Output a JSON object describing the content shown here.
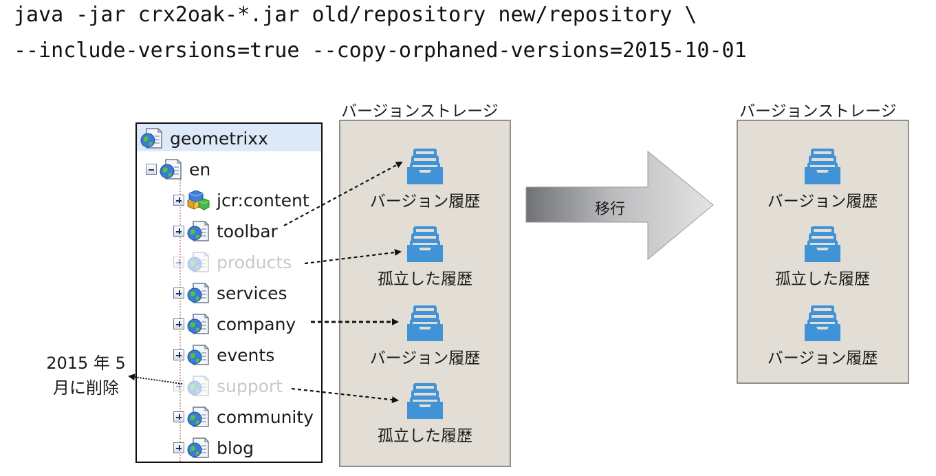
{
  "command": {
    "line1": "java -jar crx2oak-*.jar old/repository new/repository \\",
    "line2": "--include-versions=true --copy-orphaned-versions=2015-10-01"
  },
  "tree": {
    "root": "geometrixx",
    "child": "en",
    "nodes": [
      {
        "label": "jcr:content",
        "icon": "cubes-icon",
        "faded": false
      },
      {
        "label": "toolbar",
        "icon": "page-icon",
        "faded": false
      },
      {
        "label": "products",
        "icon": "page-icon",
        "faded": true
      },
      {
        "label": "services",
        "icon": "page-icon",
        "faded": false
      },
      {
        "label": "company",
        "icon": "page-icon",
        "faded": false
      },
      {
        "label": "events",
        "icon": "page-icon",
        "faded": false
      },
      {
        "label": "support",
        "icon": "page-icon",
        "faded": true
      },
      {
        "label": "community",
        "icon": "page-icon",
        "faded": false
      },
      {
        "label": "blog",
        "icon": "page-icon",
        "faded": false
      }
    ]
  },
  "deleted_note": {
    "line1": "2015 年 5",
    "line2": "月に削除"
  },
  "storage_before": {
    "title": "バージョンストレージ",
    "items": [
      "バージョン履歴",
      "孤立した履歴",
      "バージョン履歴",
      "孤立した履歴"
    ]
  },
  "migration_arrow": {
    "label": "移行"
  },
  "storage_after": {
    "title": "バージョンストレージ",
    "items": [
      "バージョン履歴",
      "孤立した履歴",
      "バージョン履歴"
    ]
  },
  "colors": {
    "tray_blue": "#3f93d6",
    "storage_bg": "#e2ded6",
    "tree_root_highlight": "#dde9f8",
    "arrow_gradient_start": "#707277",
    "arrow_gradient_end": "#dcdcdc"
  }
}
